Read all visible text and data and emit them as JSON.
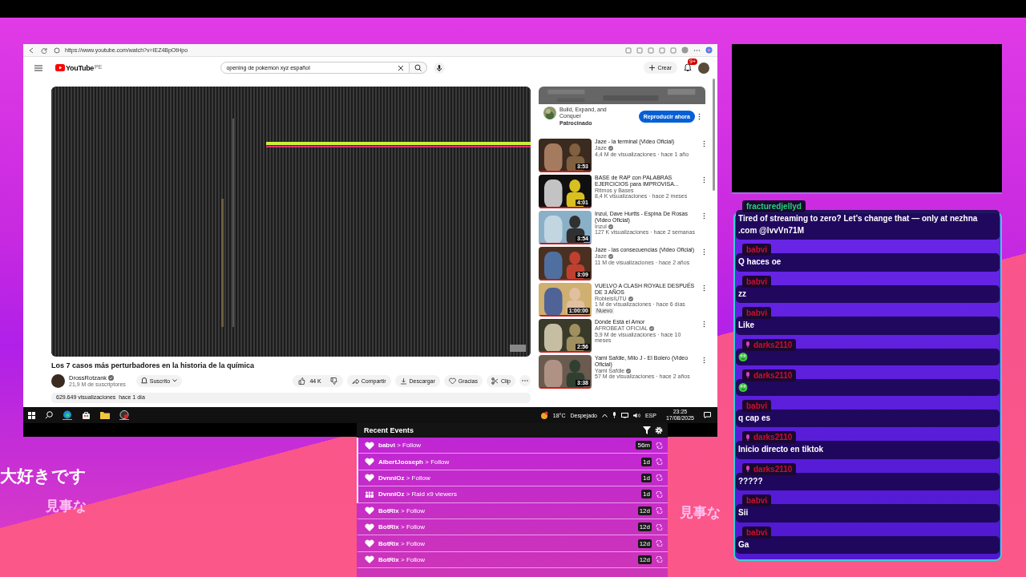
{
  "background_texts": [
    "大好きです",
    "見事な",
    "見事な"
  ],
  "browser": {
    "url": "https://www.youtube.com/watch?v=IEZ4BpOtHpo"
  },
  "youtube": {
    "logo": "YouTube",
    "region": "PE",
    "search": "opening de pokemon xyz español",
    "create": "Crear",
    "notifications": "9+",
    "video": {
      "title": "Los 7 casos más perturbadores en la historia de la química",
      "channel": "DrossRotzank",
      "verified": true,
      "subscribers": "21,9 M de suscriptores",
      "subscribe": "Suscrito",
      "likes": "44 K",
      "actions": [
        "Compartir",
        "Descargar",
        "Gracias",
        "Clip"
      ],
      "views": "629.649 visualizaciones  hace 1 día"
    },
    "ad": {
      "title": "Build, Expand, and Conquer",
      "sponsor": "Patrocinado",
      "button": "Reproducir ahora"
    },
    "recommended": [
      {
        "title": "Jaze - la terminal (Video Oficial)",
        "channel": "Jaze",
        "verified": true,
        "meta": "4,4 M de visualizaciones · hace 1 año",
        "duration": "3:53"
      },
      {
        "title": "BASE de RAP con PALABRAS EJERCICIOS para IMPROVISA...",
        "channel": "Ritmos y Bases",
        "verified": false,
        "meta": "8,4 K visualizaciones · hace 2 meses",
        "duration": "4:01"
      },
      {
        "title": "Inzul, Dave Hurtts - Espina De Rosas (Video Oficial)",
        "channel": "Inzul",
        "verified": true,
        "meta": "127 K visualizaciones · hace 2 semanas",
        "duration": "3:54"
      },
      {
        "title": "Jaze - las consecuencias (Video Oficial)",
        "channel": "Jaze",
        "verified": true,
        "meta": "11 M de visualizaciones · hace 2 años",
        "duration": "3:09"
      },
      {
        "title": "VUELVO A CLASH ROYALE DESPUÉS DE 3 AÑOS",
        "channel": "RobleisIUTU",
        "verified": true,
        "meta": "1 M de visualizaciones · hace 6 días",
        "duration": "1:00:00",
        "badge": "Nuevo"
      },
      {
        "title": "Dónde Está el Amor",
        "channel": "AFROBEAT OFICIAL",
        "verified": true,
        "meta": "5,9 M de visualizaciones · hace 10 meses",
        "duration": "2:56"
      },
      {
        "title": "Yami Safdie, Milo J - El Bolero (Video Oficial)",
        "channel": "Yami Safdie",
        "verified": true,
        "meta": "57 M de visualizaciones · hace 2 años",
        "duration": "3:38"
      }
    ]
  },
  "taskbar": {
    "temperature": "18°C",
    "condition": "Despejado",
    "language": "ESP",
    "time": "23:25",
    "date": "17/08/2025"
  },
  "recent_events": {
    "title": "Recent Events",
    "events": [
      {
        "kind": "follow",
        "user": "babvi",
        "action": "> Follow",
        "age": "56m",
        "marked": true
      },
      {
        "kind": "follow",
        "user": "AlbertJooseph",
        "action": "> Follow",
        "age": "1d",
        "marked": true
      },
      {
        "kind": "follow",
        "user": "DvnniOz",
        "action": "> Follow",
        "age": "1d",
        "marked": true
      },
      {
        "kind": "raid",
        "user": "DvnniOz",
        "action": "> Raid x9 viewers",
        "age": "1d",
        "marked": true
      },
      {
        "kind": "follow",
        "user": "BotRix",
        "action": "> Follow",
        "age": "12d",
        "marked": false
      },
      {
        "kind": "follow",
        "user": "BotRix",
        "action": "> Follow",
        "age": "12d",
        "marked": false
      },
      {
        "kind": "follow",
        "user": "BotRix",
        "action": "> Follow",
        "age": "12d",
        "marked": false
      },
      {
        "kind": "follow",
        "user": "BotRix",
        "action": "> Follow",
        "age": "12d",
        "marked": false
      }
    ]
  },
  "chat": {
    "messages": [
      {
        "user": "fracturedjellyd",
        "color": "#1fd67a",
        "badge": false,
        "kind": "text",
        "text": "Tired of streaming to zero? Let’s change that — only at nezhna .com @lvvVn71M"
      },
      {
        "user": "babvi",
        "color": "#c8102e",
        "badge": false,
        "kind": "text",
        "text": "Q haces oe"
      },
      {
        "user": "babvi",
        "color": "#c8102e",
        "badge": false,
        "kind": "text",
        "text": "zz"
      },
      {
        "user": "babvi",
        "color": "#c8102e",
        "badge": false,
        "kind": "text",
        "text": "Like"
      },
      {
        "user": "darks2110",
        "color": "#c8102e",
        "badge": true,
        "kind": "emote"
      },
      {
        "user": "darks2110",
        "color": "#c8102e",
        "badge": true,
        "kind": "emote"
      },
      {
        "user": "babvi",
        "color": "#c8102e",
        "badge": false,
        "kind": "text",
        "text": "q cap es"
      },
      {
        "user": "darks2110",
        "color": "#c8102e",
        "badge": true,
        "kind": "text",
        "text": "Inicio directo en tiktok"
      },
      {
        "user": "darks2110",
        "color": "#c8102e",
        "badge": true,
        "kind": "text",
        "text": "?????"
      },
      {
        "user": "babvi",
        "color": "#c8102e",
        "badge": false,
        "kind": "text",
        "text": "Sii"
      },
      {
        "user": "babvi",
        "color": "#c8102e",
        "badge": false,
        "kind": "text",
        "text": "Ga"
      }
    ]
  }
}
